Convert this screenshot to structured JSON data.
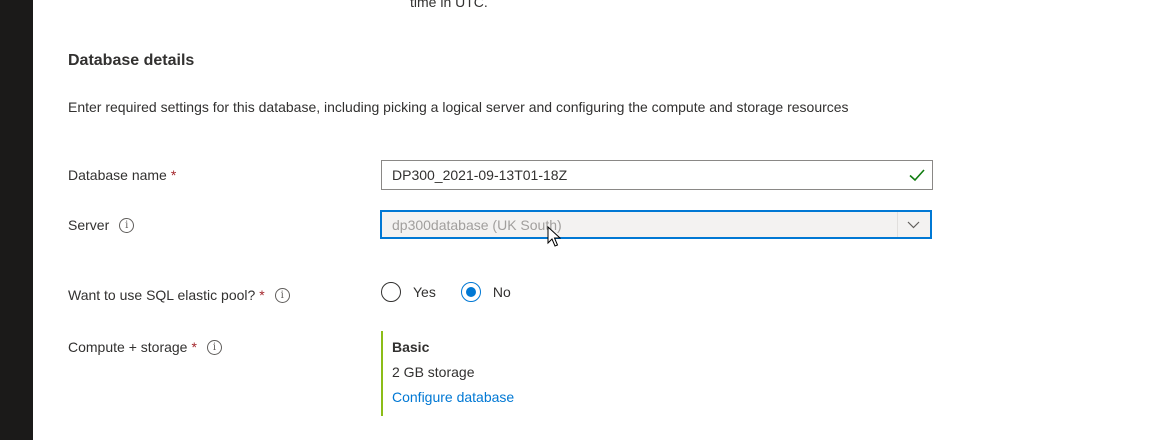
{
  "top_text": "time in UTC.",
  "section": {
    "title": "Database details",
    "description": "Enter required settings for this database, including picking a logical server and configuring the compute and storage resources"
  },
  "fields": {
    "database_name": {
      "label": "Database name",
      "required": "*",
      "value": "DP300_2021-09-13T01-18Z"
    },
    "server": {
      "label": "Server",
      "value": "dp300database (UK South)"
    },
    "elastic_pool": {
      "label": "Want to use SQL elastic pool?",
      "required": "*",
      "options": [
        "Yes",
        "No"
      ],
      "selected": "No"
    },
    "compute": {
      "label": "Compute + storage",
      "required": "*",
      "tier": "Basic",
      "storage": "2 GB storage",
      "link": "Configure database"
    }
  },
  "icons": {
    "info": "info-icon",
    "check": "checkmark-icon",
    "chevron": "chevron-down-icon"
  },
  "colors": {
    "accent": "#0078d4",
    "required": "#a4262c",
    "valid": "#107c10",
    "compute_border": "#8cbd18"
  }
}
